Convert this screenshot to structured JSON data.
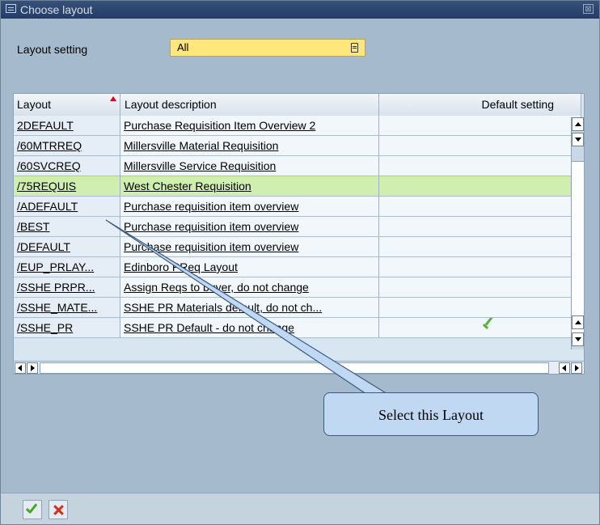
{
  "dialog": {
    "title": "Choose layout",
    "close_glyph": "⊠"
  },
  "layout_setting": {
    "label": "Layout setting",
    "value": "All"
  },
  "table": {
    "headers": [
      "Layout",
      "Layout description",
      "Default setting"
    ],
    "rows": [
      {
        "layout": "2DEFAULT",
        "description": "Purchase Requisition Item Overview 2",
        "default": false
      },
      {
        "layout": "/60MTRREQ",
        "description": "Millersville Material Requisition",
        "default": false
      },
      {
        "layout": "/60SVCREQ",
        "description": "Millersville Service Requisition",
        "default": false
      },
      {
        "layout": "/75REQUIS",
        "description": "West Chester Requisition",
        "default": false,
        "selected": true
      },
      {
        "layout": "/ADEFAULT",
        "description": "Purchase requisition item overview",
        "default": false
      },
      {
        "layout": "/BEST",
        "description": "Purchase requisition item overview",
        "default": false
      },
      {
        "layout": "/DEFAULT",
        "description": "Purchase requisition item overview",
        "default": false
      },
      {
        "layout": "/EUP_PRLAY...",
        "description": "Edinboro PReq Layout",
        "default": false
      },
      {
        "layout": "/SSHE PRPR...",
        "description": "Assign Reqs to buyer, do not change",
        "default": false
      },
      {
        "layout": "/SSHE_MATE...",
        "description": "SSHE PR Materials default, do not ch...",
        "default": false
      },
      {
        "layout": "/SSHE_PR",
        "description": "SSHE PR Default - do not change",
        "default": true
      }
    ]
  },
  "callout": {
    "text": "Select this Layout"
  },
  "footer": {
    "buttons": [
      "ok",
      "cancel"
    ]
  },
  "colors": {
    "selected_row": "#cfeeb0",
    "input_bg": "#ffe67d",
    "title_bar": "#243d66"
  }
}
